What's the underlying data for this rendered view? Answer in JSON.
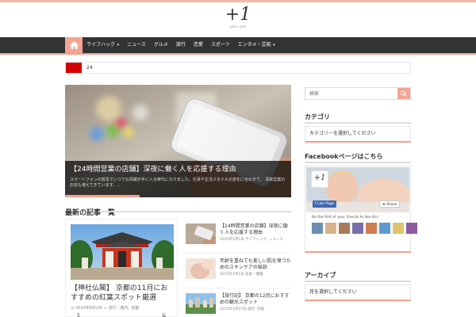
{
  "site": {
    "logo_mark": "+1",
    "logo_sub": "plus one"
  },
  "nav": {
    "home_icon": "home-icon",
    "items": [
      {
        "label": "ライフハック",
        "has_dropdown": true
      },
      {
        "label": "ニュース",
        "has_dropdown": false
      },
      {
        "label": "グルメ",
        "has_dropdown": false
      },
      {
        "label": "旅行",
        "has_dropdown": false
      },
      {
        "label": "恋愛",
        "has_dropdown": false
      },
      {
        "label": "スポーツ",
        "has_dropdown": false
      },
      {
        "label": "エンタメ・芸能",
        "has_dropdown": true
      }
    ]
  },
  "ticker": {
    "text": "24"
  },
  "slider": {
    "title": "【24時間営業の店舗】深夜に働く人を応援する理由",
    "excerpt": "スマートフォンの普及でいつでも情報が手に入る時代になりました。仕事や生活スタイルの変化に合わせて、 深夜営業のお店も増えてきています。...",
    "progress_fraction": 0.33
  },
  "section": {
    "title": "最新の記事一覧"
  },
  "feature": {
    "title": "【神社仏閣】 京都の11月におすすめの紅葉スポット厳選",
    "date": "2014年8月1日",
    "category": "旅行・観光",
    "tag": "京都",
    "extra_left": "5",
    "extra_right": "&"
  },
  "posts": [
    {
      "title": "【24時間営業の店舗】深夜に働く人を応援する理由",
      "date": "2015年1月1日",
      "category": "ライフハック, ニュース"
    },
    {
      "title": "年齢を重ねても美しい肌を保つためのスキンケアの秘訣",
      "date": "2015年1月1日",
      "category": "美容・健康"
    },
    {
      "title": "【旅行記】 京都の12月におすすめの観光スポット",
      "date": "2015年1月27日",
      "category": "旅行, 京都"
    }
  ],
  "sidebar": {
    "search_placeholder": "検索",
    "widget1": {
      "title": "カテゴリ",
      "text": "カテゴリーを選択してください"
    },
    "facebook": {
      "title": "Facebookページはこちら",
      "logo_mark": "+1",
      "like_label": "f Like Page",
      "share_label": "➦ Share",
      "friends_text": "Be the first of your friends to like this",
      "avatar_colors": [
        "#6b8fb3",
        "#d9b48a",
        "#a57b5a",
        "#7a6fa8",
        "#d07c4f",
        "#5c9bd1",
        "#e2c36d",
        "#8c5a9e"
      ]
    },
    "widget3": {
      "title": "アーカイブ",
      "text": "月を選択してください"
    }
  },
  "colors": {
    "accent": "#f4a492",
    "nav_bg": "#333333",
    "ticker_red": "#d30000"
  }
}
